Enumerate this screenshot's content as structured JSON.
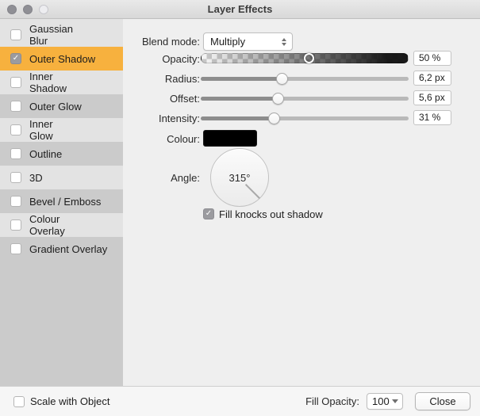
{
  "window": {
    "title": "Layer Effects"
  },
  "sidebar": {
    "items": [
      {
        "label": "Gaussian Blur",
        "checked": false,
        "selected": false,
        "shade": "light"
      },
      {
        "label": "Outer Shadow",
        "checked": true,
        "selected": true,
        "shade": "accent"
      },
      {
        "label": "Inner Shadow",
        "checked": false,
        "selected": false,
        "shade": "light"
      },
      {
        "label": "Outer Glow",
        "checked": false,
        "selected": false,
        "shade": "dark"
      },
      {
        "label": "Inner Glow",
        "checked": false,
        "selected": false,
        "shade": "light"
      },
      {
        "label": "Outline",
        "checked": false,
        "selected": false,
        "shade": "dark"
      },
      {
        "label": "3D",
        "checked": false,
        "selected": false,
        "shade": "light"
      },
      {
        "label": "Bevel / Emboss",
        "checked": false,
        "selected": false,
        "shade": "dark"
      },
      {
        "label": "Colour Overlay",
        "checked": false,
        "selected": false,
        "shade": "light"
      },
      {
        "label": "Gradient Overlay",
        "checked": false,
        "selected": false,
        "shade": "dark"
      }
    ]
  },
  "panel": {
    "blend_mode": {
      "label": "Blend mode:",
      "value": "Multiply"
    },
    "sliders": [
      {
        "id": "opacity",
        "label": "Opacity:",
        "value": "50 %",
        "percent": 52,
        "style": "checker"
      },
      {
        "id": "radius",
        "label": "Radius:",
        "value": "6,2 px",
        "percent": 39,
        "style": "plain"
      },
      {
        "id": "offset",
        "label": "Offset:",
        "value": "5,6 px",
        "percent": 37,
        "style": "plain"
      },
      {
        "id": "intensity",
        "label": "Intensity:",
        "value": "31 %",
        "percent": 35,
        "style": "plain"
      }
    ],
    "colour": {
      "label": "Colour:",
      "value_hex": "#000000"
    },
    "angle": {
      "label": "Angle:",
      "value": "315°",
      "degrees": 315
    },
    "fill_knocks_out_shadow": {
      "label": "Fill knocks out shadow",
      "checked": true
    }
  },
  "footer": {
    "scale_with_object": {
      "label": "Scale with Object",
      "checked": false
    },
    "fill_opacity": {
      "label": "Fill Opacity:",
      "value": "100"
    },
    "close_button": {
      "label": "Close"
    }
  },
  "colors": {
    "accent": "#f7b13e",
    "sidebar_light": "#e3e3e3",
    "sidebar_dark": "#cbcbcb",
    "slider_filled": "#8d8d8d",
    "slider_empty": "#b9b9b9",
    "swatch": "#000000"
  }
}
